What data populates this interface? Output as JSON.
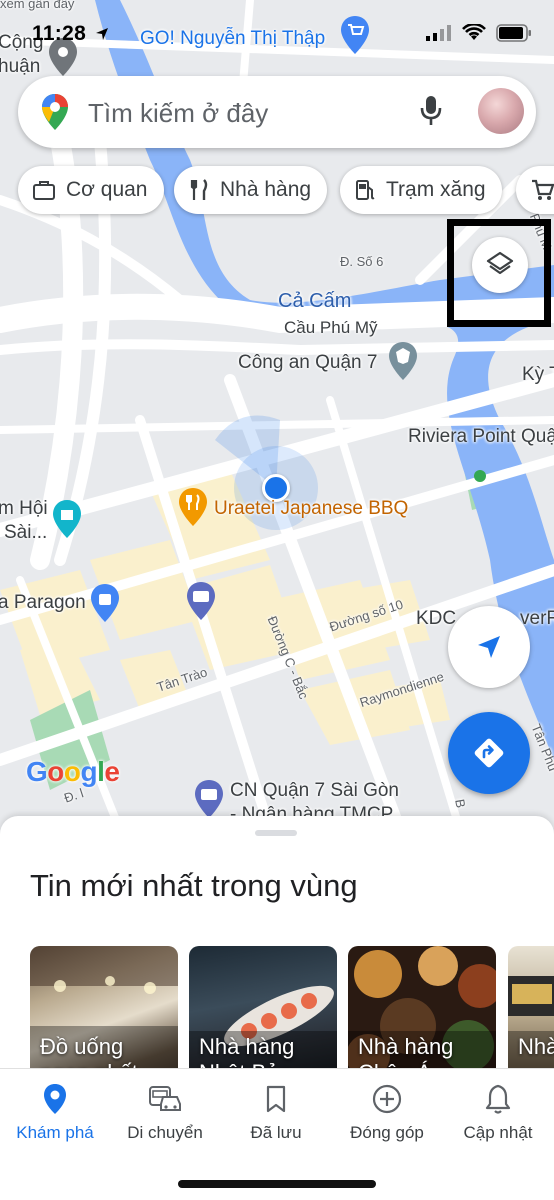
{
  "status": {
    "time": "11:28"
  },
  "map": {
    "labels": {
      "top_left_1": "Cộng",
      "top_left_2": "huận",
      "top_left_cut": "xem gần đây",
      "go_store": "GO! Nguyễn Thị Thập",
      "street_so6": "Đ. Số 6",
      "river": "Cả Cấm",
      "bridge": "Cầu Phú Mỹ",
      "police": "Công an Quận 7",
      "ky": "Kỳ T",
      "riviera": "Riviera Point Quậ",
      "hoi": "m Hội",
      "sai": "Sài...",
      "restaurant": "Uraetei Japanese BBQ",
      "paragon": "a Paragon",
      "kdc": "KDC",
      "river_right": "verRi",
      "duong_so10": "Đường số 10",
      "tan_trao": "Tân Trào",
      "duong_c_bac": "Đường C - Bắc",
      "raymondienne": "Raymondienne",
      "tan_phu": "Tân Phú",
      "b_label": "B",
      "d_label": "Đ. l",
      "cn_q7": "CN Quận 7 Sài Gòn",
      "bank": "- Ngân hàng TMCP",
      "phu_m": "Phú M"
    },
    "google_logo": [
      "G",
      "o",
      "o",
      "g",
      "l",
      "e"
    ],
    "colors": {
      "accent": "#1a73e8",
      "water": "#8ab4f8",
      "block": "#fdf3d0",
      "park": "#a8dab5"
    }
  },
  "search": {
    "placeholder": "Tìm kiếm ở đây"
  },
  "chips": [
    {
      "label": "Cơ quan",
      "icon": "briefcase-icon"
    },
    {
      "label": "Nhà hàng",
      "icon": "fork-knife-icon"
    },
    {
      "label": "Trạm xăng",
      "icon": "gas-pump-icon"
    },
    {
      "label": "",
      "icon": "shopping-cart-icon"
    }
  ],
  "sheet": {
    "title": "Tin mới nhất trong vùng",
    "cards": [
      {
        "label": "Đồ uống",
        "label2": "ngon nhất"
      },
      {
        "label": "Nhà hàng",
        "label2": "Nhật Bản"
      },
      {
        "label": "Nhà hàng",
        "label2": "Châu Á"
      },
      {
        "label": "Nhà",
        "label2": ""
      }
    ]
  },
  "nav": [
    {
      "label": "Khám phá",
      "icon": "map-pin-icon",
      "active": true
    },
    {
      "label": "Di chuyển",
      "icon": "commute-icon",
      "active": false
    },
    {
      "label": "Đã lưu",
      "icon": "bookmark-icon",
      "active": false
    },
    {
      "label": "Đóng góp",
      "icon": "add-circle-icon",
      "active": false
    },
    {
      "label": "Cập nhật",
      "icon": "bell-icon",
      "active": false
    }
  ]
}
